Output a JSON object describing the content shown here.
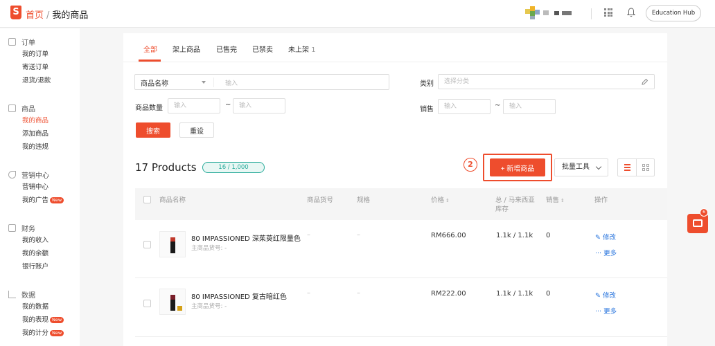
{
  "header": {
    "logo_letter": "S",
    "breadcrumb_home": "首页",
    "breadcrumb_sep": "/",
    "breadcrumb_current": "我的商品",
    "edu_button": "Education Hub"
  },
  "sidebar": {
    "sections": [
      {
        "title": "订单",
        "items": [
          "我的订单",
          "寄送订单",
          "退货/退款"
        ]
      },
      {
        "title": "商品",
        "items": [
          "我的商品",
          "添加商品",
          "我的违规"
        ]
      },
      {
        "title": "营销中心",
        "items": [
          "营销中心",
          "我的广告"
        ]
      },
      {
        "title": "财务",
        "items": [
          "我的收入",
          "我的余额",
          "银行账户"
        ]
      },
      {
        "title": "数据",
        "items": [
          "我的数据",
          "我的表现",
          "我的计分"
        ]
      }
    ],
    "new_tag": "New"
  },
  "tabs": [
    "全部",
    "架上商品",
    "已售完",
    "已禁卖",
    "未上架"
  ],
  "tab_badge": "1",
  "filters": {
    "name_select": "商品名称",
    "input_placeholder": "输入",
    "category_label": "类别",
    "category_placeholder": "选择分类",
    "quantity_label": "商品数量",
    "sales_label": "销售",
    "range_sep": "~",
    "search_button": "搜索",
    "reset_button": "重设"
  },
  "summary": {
    "count_title": "17 Products",
    "quota": "16 / 1,000",
    "step_number": "2",
    "add_button": "+ 新增商品",
    "bulk_tools": "批量工具"
  },
  "table": {
    "headers": {
      "name": "商品名称",
      "sku": "商品货号",
      "variation": "规格",
      "price": "价格",
      "stock_line1": "总 / 马来西亚",
      "stock_line2": "库存",
      "sales": "销售",
      "actions": "操作"
    },
    "rows": [
      {
        "name": "80 IMPASSIONED 深茱萸红限量色",
        "sub": "主商品货号: -",
        "sku": "–",
        "variation": "–",
        "price": "RM666.00",
        "stock": "1.1k / 1.1k",
        "sales": "0",
        "edit": "修改",
        "more": "更多"
      },
      {
        "name": "80 IMPASSIONED 复古暗红色",
        "sub": "主商品货号: -",
        "sku": "–",
        "variation": "–",
        "price": "RM222.00",
        "stock": "1.1k / 1.1k",
        "sales": "0",
        "edit": "修改",
        "more": "更多"
      }
    ]
  },
  "chat": {
    "badge": "6"
  },
  "colors": {
    "brand": "#ee4d2d",
    "link": "#2673dd",
    "quota": "#26aa99"
  }
}
